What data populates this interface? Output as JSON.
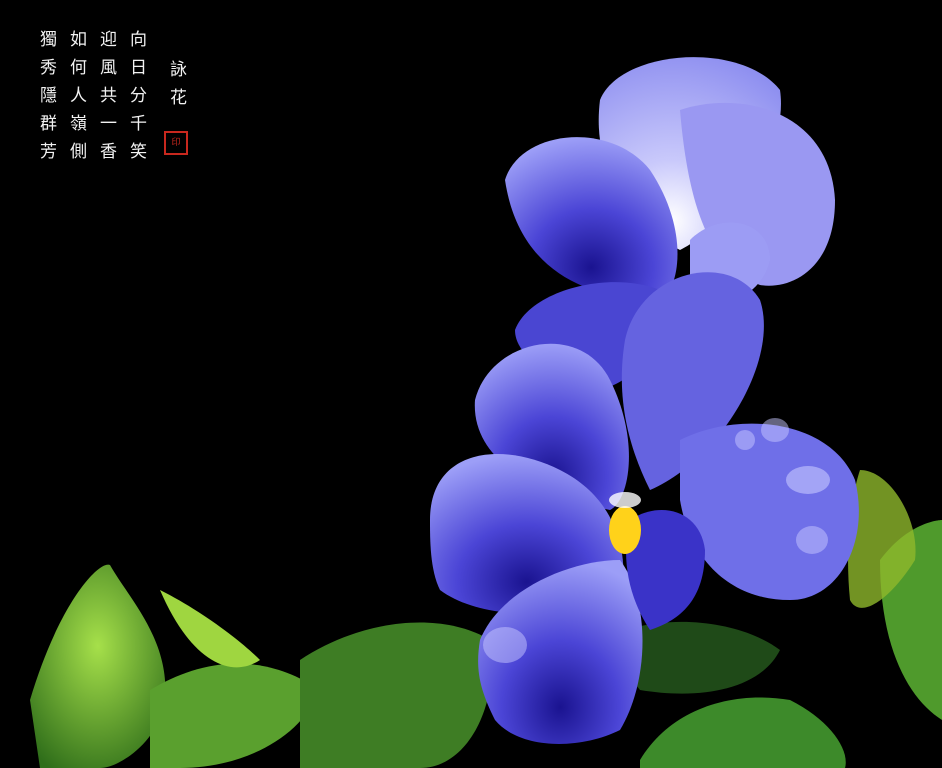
{
  "poem": {
    "title": "詠花",
    "lines": [
      "向日分千笑",
      "迎風共一香",
      "如何人嶺側",
      "獨秀隱群芳"
    ],
    "seal_text": "印"
  },
  "image": {
    "subject": "pansy-flowers",
    "colors": {
      "background": "#000000",
      "petal_light": "#8d8ff5",
      "petal_dark": "#2a1fa8",
      "center": "#ffd21a",
      "leaf": "#5fa82a",
      "seal": "#c8281e"
    }
  }
}
